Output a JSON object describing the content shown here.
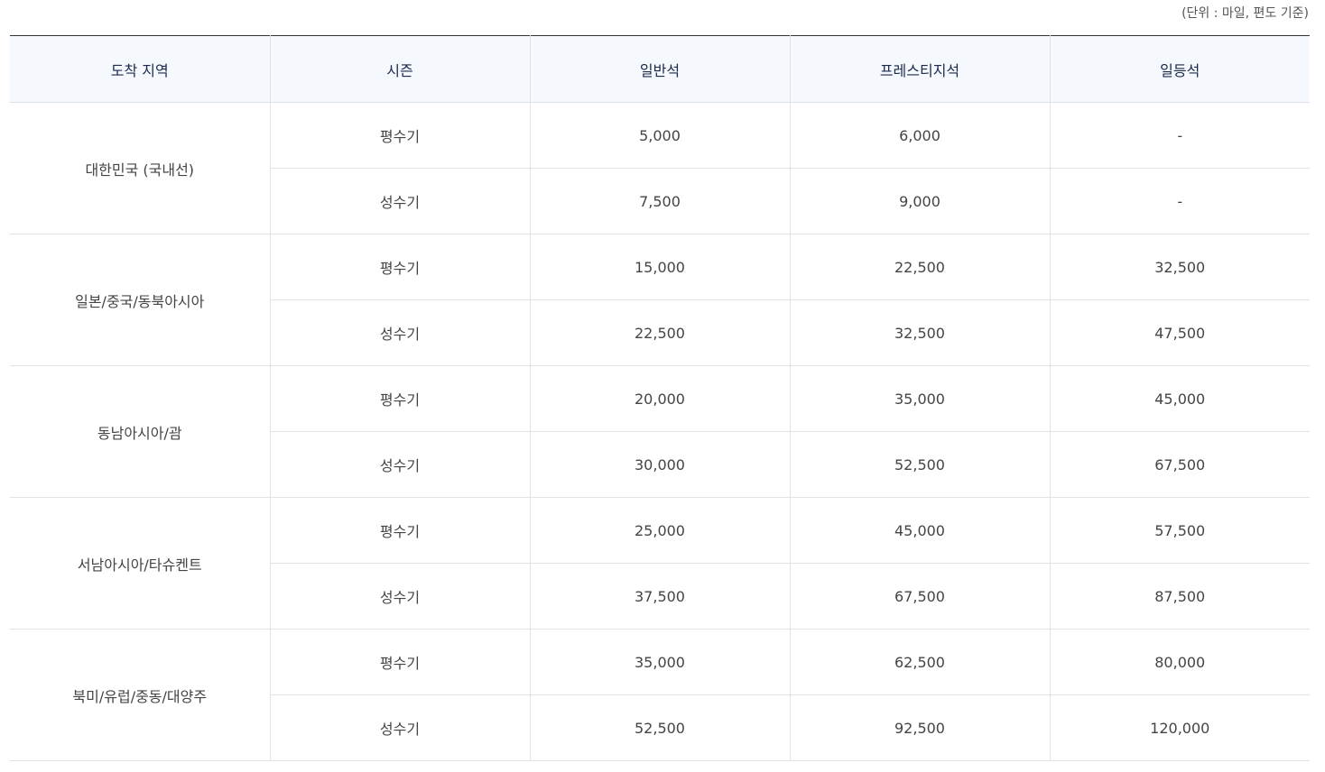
{
  "unit_note": "(단위 : 마일, 편도 기준)",
  "headers": [
    "도착 지역",
    "시즌",
    "일반석",
    "프레스티지석",
    "일등석"
  ],
  "regions": [
    {
      "name": "대한민국 (국내선)",
      "rows": [
        {
          "season": "평수기",
          "economy": "5,000",
          "prestige": "6,000",
          "first": "-"
        },
        {
          "season": "성수기",
          "economy": "7,500",
          "prestige": "9,000",
          "first": "-"
        }
      ]
    },
    {
      "name": "일본/중국/동북아시아",
      "rows": [
        {
          "season": "평수기",
          "economy": "15,000",
          "prestige": "22,500",
          "first": "32,500"
        },
        {
          "season": "성수기",
          "economy": "22,500",
          "prestige": "32,500",
          "first": "47,500"
        }
      ]
    },
    {
      "name": "동남아시아/괌",
      "rows": [
        {
          "season": "평수기",
          "economy": "20,000",
          "prestige": "35,000",
          "first": "45,000"
        },
        {
          "season": "성수기",
          "economy": "30,000",
          "prestige": "52,500",
          "first": "67,500"
        }
      ]
    },
    {
      "name": "서남아시아/타슈켄트",
      "rows": [
        {
          "season": "평수기",
          "economy": "25,000",
          "prestige": "45,000",
          "first": "57,500"
        },
        {
          "season": "성수기",
          "economy": "37,500",
          "prestige": "67,500",
          "first": "87,500"
        }
      ]
    },
    {
      "name": "북미/유럽/중동/대양주",
      "rows": [
        {
          "season": "평수기",
          "economy": "35,000",
          "prestige": "62,500",
          "first": "80,000"
        },
        {
          "season": "성수기",
          "economy": "52,500",
          "prestige": "92,500",
          "first": "120,000"
        }
      ]
    }
  ]
}
